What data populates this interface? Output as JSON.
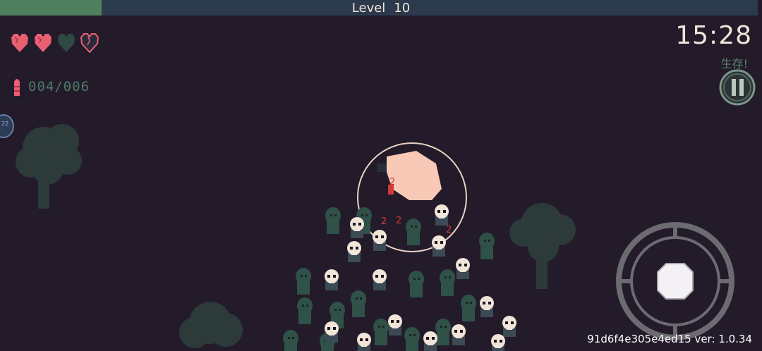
{
  "hud": {
    "level_label": "Level",
    "level_value": "10",
    "xp_fraction": 0.134,
    "hearts": [
      "filled",
      "filled",
      "empty",
      "outline-cracked"
    ],
    "ammo": "004/006",
    "timer": "15:28",
    "objective": "生存!",
    "version": "91d6f4e305e4ed15 ver: 1.0.34"
  },
  "colors": {
    "background": "#231a2a",
    "xp_bar": "#2b3a4c",
    "xp_fill": "#4e7f5e",
    "heart": "#e86072",
    "ammo_text": "#4e7a66",
    "enemy_body": "#2f5148",
    "skull": "#f1e4d8",
    "damage_number": "#d23a3a"
  },
  "damage_numbers": [
    "2",
    "2",
    "2",
    "2"
  ],
  "icons": [
    "heart-icon",
    "bullet-icon",
    "pause-icon",
    "crosshair-joystick-icon",
    "skill-badge-icon"
  ]
}
